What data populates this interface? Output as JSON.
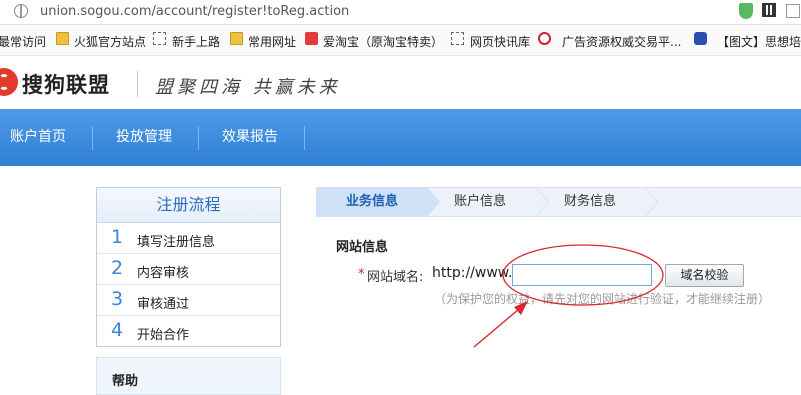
{
  "browser": {
    "url": "union.sogou.com/account/register!toReg.action",
    "bookmarks": [
      {
        "label": "最常访问",
        "icon": "none"
      },
      {
        "label": "火狐官方站点",
        "icon": "folder-icon"
      },
      {
        "label": "新手上路",
        "icon": "page-icon"
      },
      {
        "label": "常用网址",
        "icon": "folder-icon"
      },
      {
        "label": "爱淘宝（原淘宝特卖）",
        "icon": "taobao-icon"
      },
      {
        "label": "网页快讯库",
        "icon": "page-icon"
      },
      {
        "label": "广告资源权威交易平...",
        "icon": "cc-icon"
      },
      {
        "label": "【图文】思想培",
        "icon": "paw-icon"
      }
    ]
  },
  "header": {
    "logo_text": "搜狗联盟",
    "slogan": "盟聚四海 共赢未来"
  },
  "nav": {
    "items": [
      "账户首页",
      "投放管理",
      "效果报告"
    ]
  },
  "sidebar": {
    "title": "注册流程",
    "steps": [
      {
        "num": "1",
        "label": "填写注册信息"
      },
      {
        "num": "2",
        "label": "内容审核"
      },
      {
        "num": "3",
        "label": "审核通过"
      },
      {
        "num": "4",
        "label": "开始合作"
      }
    ],
    "help": "帮助"
  },
  "tabs": {
    "items": [
      "业务信息",
      "账户信息",
      "财务信息"
    ],
    "active_index": 0
  },
  "form": {
    "section_title": "网站信息",
    "required_mark": "*",
    "domain_label": "网站域名:",
    "domain_prefix": "http://www.",
    "domain_value": "",
    "verify_button": "域名校验",
    "hint": "（为保护您的权益，请先对您的网站进行验证，才能继续注册）"
  },
  "colors": {
    "nav_blue": "#3a88dc",
    "annotation_red": "#d9272e",
    "link_blue": "#2b6cc4"
  }
}
